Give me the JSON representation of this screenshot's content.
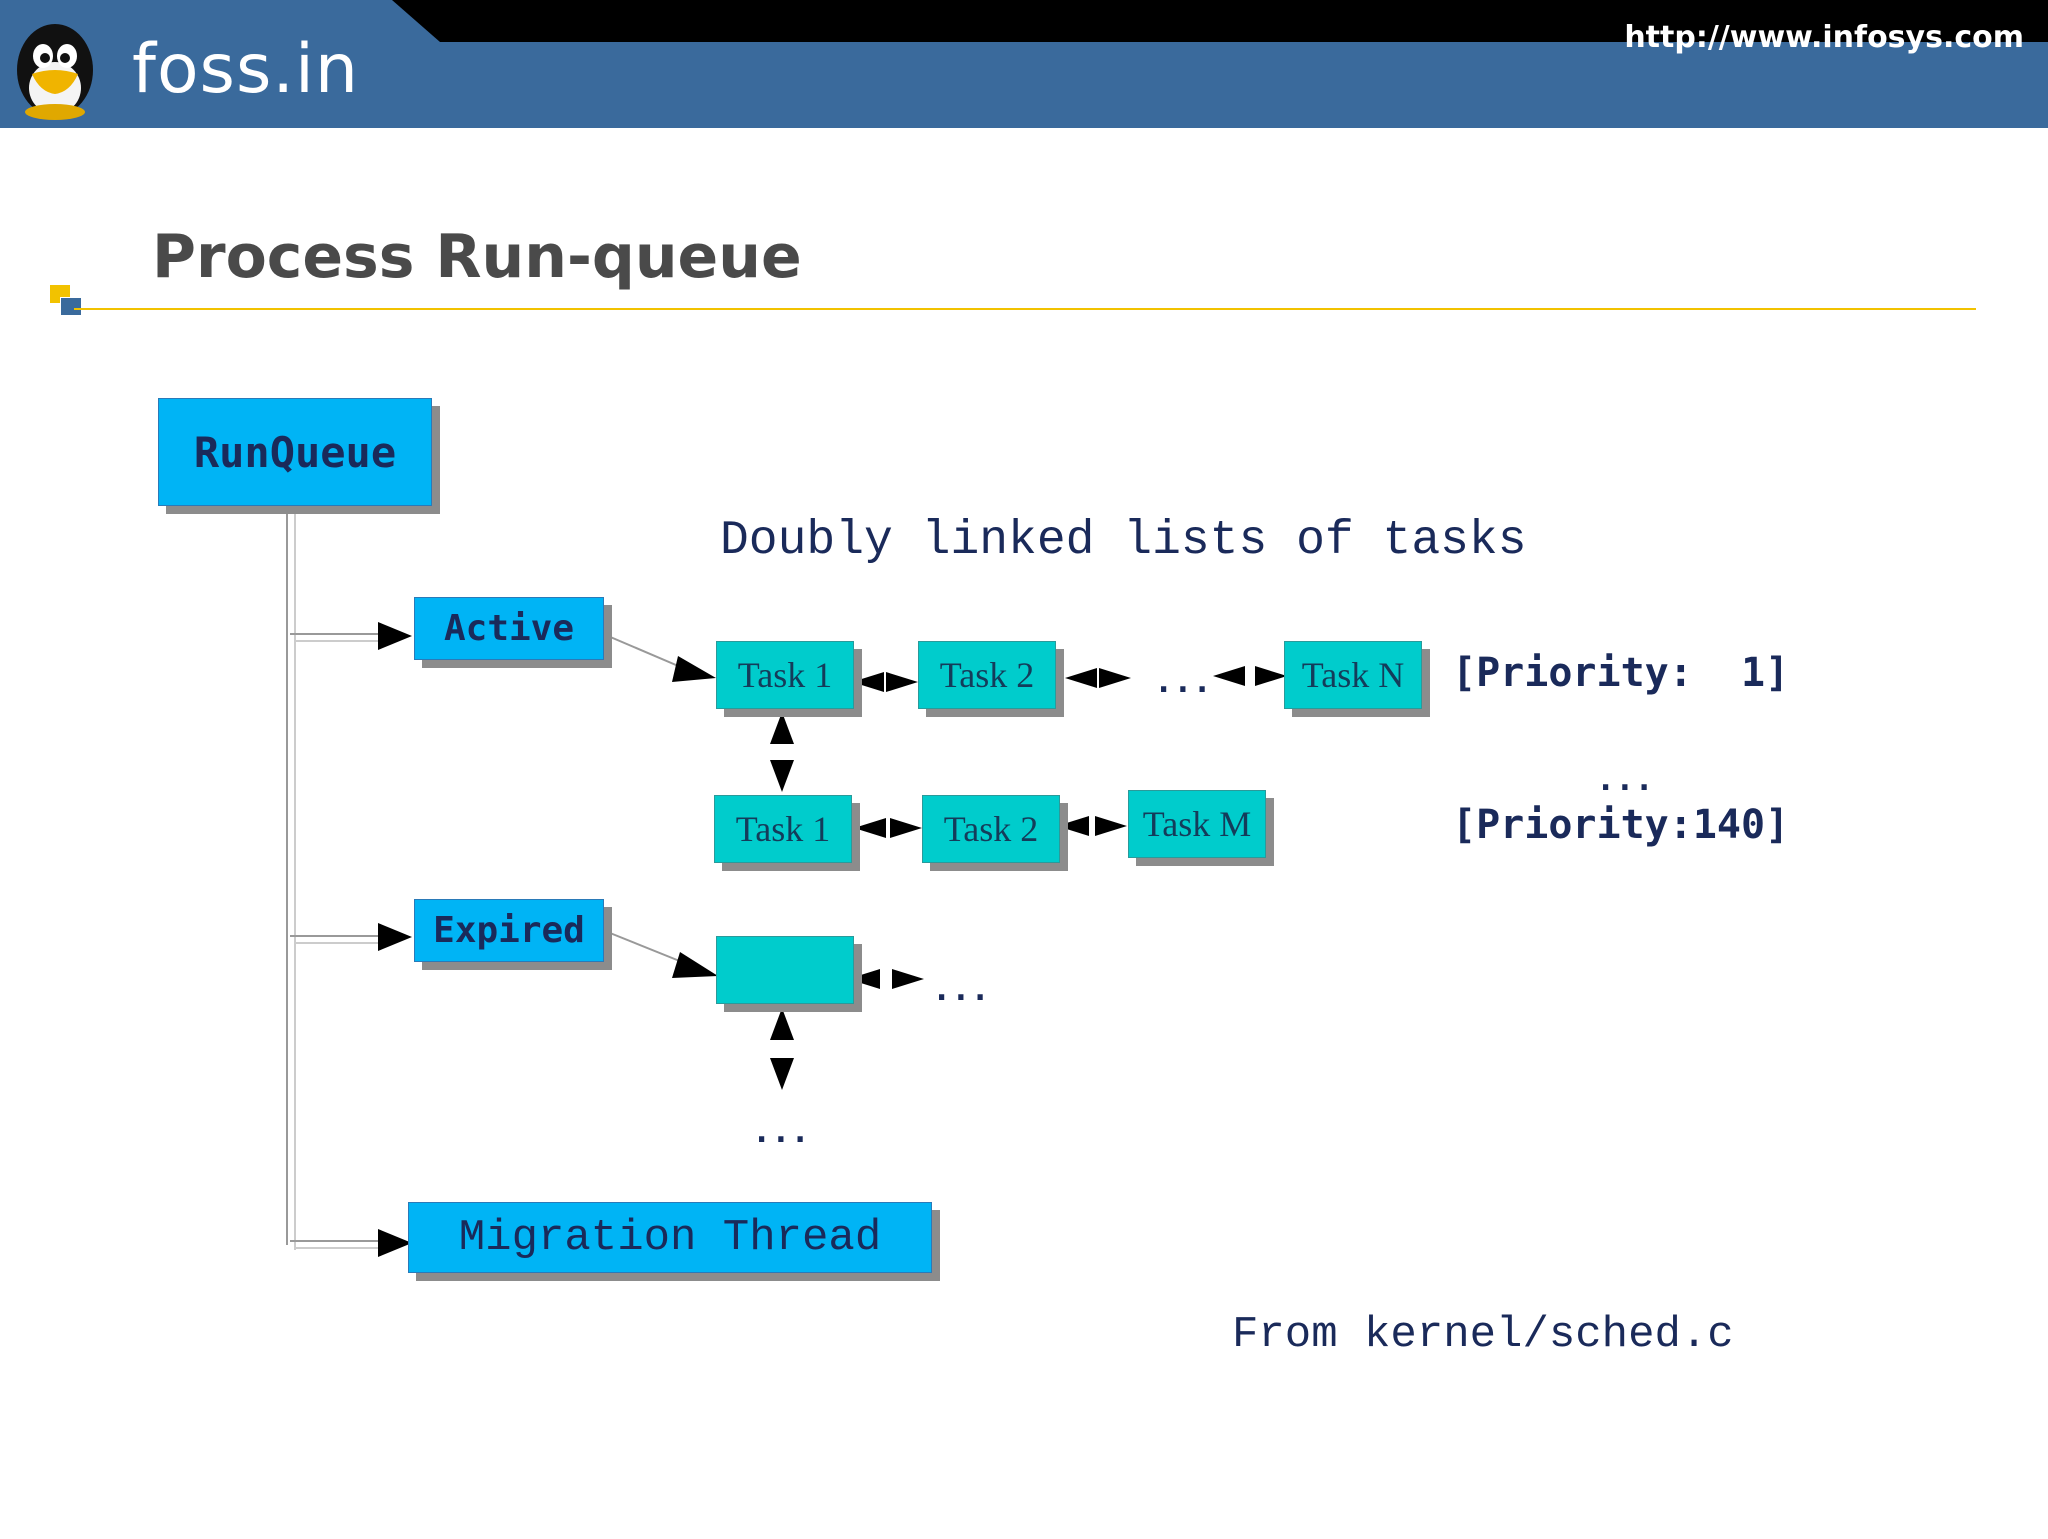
{
  "header": {
    "logo_text": "foss.in",
    "url": "http://www.infosys.com"
  },
  "slide": {
    "title": "Process Run-queue"
  },
  "diagram": {
    "runqueue": "RunQueue",
    "active": "Active",
    "expired": "Expired",
    "migration": "Migration Thread",
    "caption": "Doubly linked lists of tasks",
    "row1": {
      "task1": "Task 1",
      "task2": "Task 2",
      "ellipsis": "...",
      "taskN": "Task N"
    },
    "row2": {
      "task1": "Task 1",
      "task2": "Task 2",
      "taskM": "Task M"
    },
    "priority_first": "[Priority:  1]",
    "priority_ellipsis": "...",
    "priority_last": "[Priority:140]",
    "expired_ellipsis_right": "...",
    "expired_ellipsis_down": "...",
    "source": "From kernel/sched.c"
  },
  "colors": {
    "header_blue": "#3a6a9c",
    "box_blue": "#00b4f5",
    "box_teal": "#00cccc",
    "accent_yellow": "#f2c200"
  }
}
